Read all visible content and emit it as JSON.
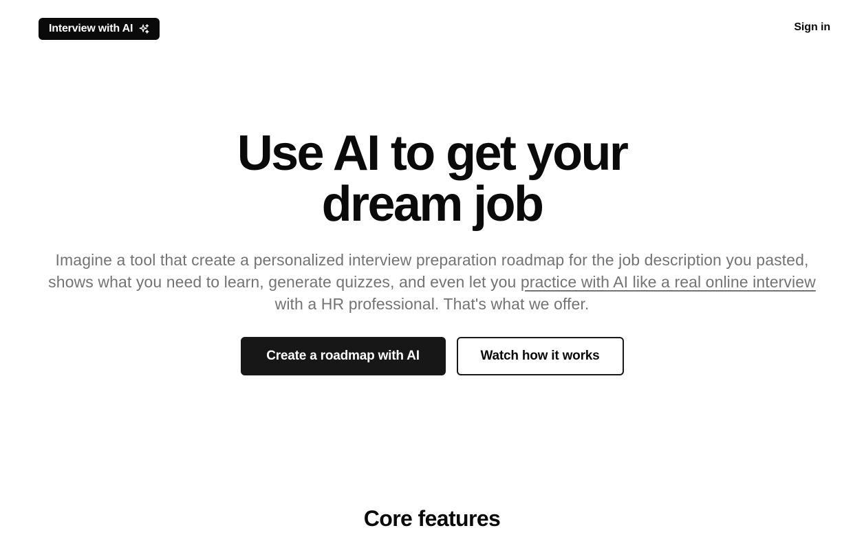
{
  "header": {
    "logo_label": "Interview with AI",
    "logo_icon": "sparkles-icon",
    "signin_label": "Sign in"
  },
  "hero": {
    "title_line1": "Use AI to get your",
    "title_line2": "dream job",
    "description_before": "Imagine a tool that create a personalized interview preparation roadmap for the job description you pasted, shows what you need to learn, generate quizzes, and even let you ",
    "description_link": "practice with AI like a real online interview",
    "description_after": " with a HR professional. That's what we offer.",
    "primary_cta": "Create a roadmap with AI",
    "secondary_cta": "Watch how it works"
  },
  "features": {
    "title": "Core features"
  },
  "colors": {
    "text": "#0a0a0a",
    "muted": "#737373",
    "primary_button": "#171717",
    "background": "#ffffff"
  }
}
